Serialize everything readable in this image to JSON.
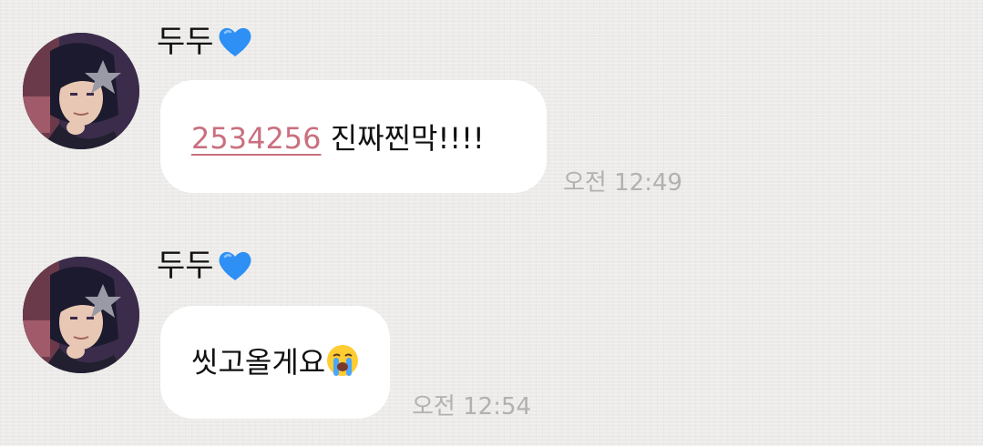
{
  "messages": [
    {
      "sender": "두두",
      "heart": "blue-heart-icon",
      "phone": "2534256",
      "text": " 진짜찐막!!!!",
      "time": "오전 12:49"
    },
    {
      "sender": "두두",
      "heart": "blue-heart-icon",
      "text": "씻고올게요",
      "emoji": "loudly-crying-face-icon",
      "time": "오전 12:54"
    }
  ],
  "colors": {
    "background": "#ecebe9",
    "bubble": "#ffffff",
    "link": "#c9707f",
    "timestamp": "#b3b1ae",
    "heart": "#2e8ff5"
  }
}
